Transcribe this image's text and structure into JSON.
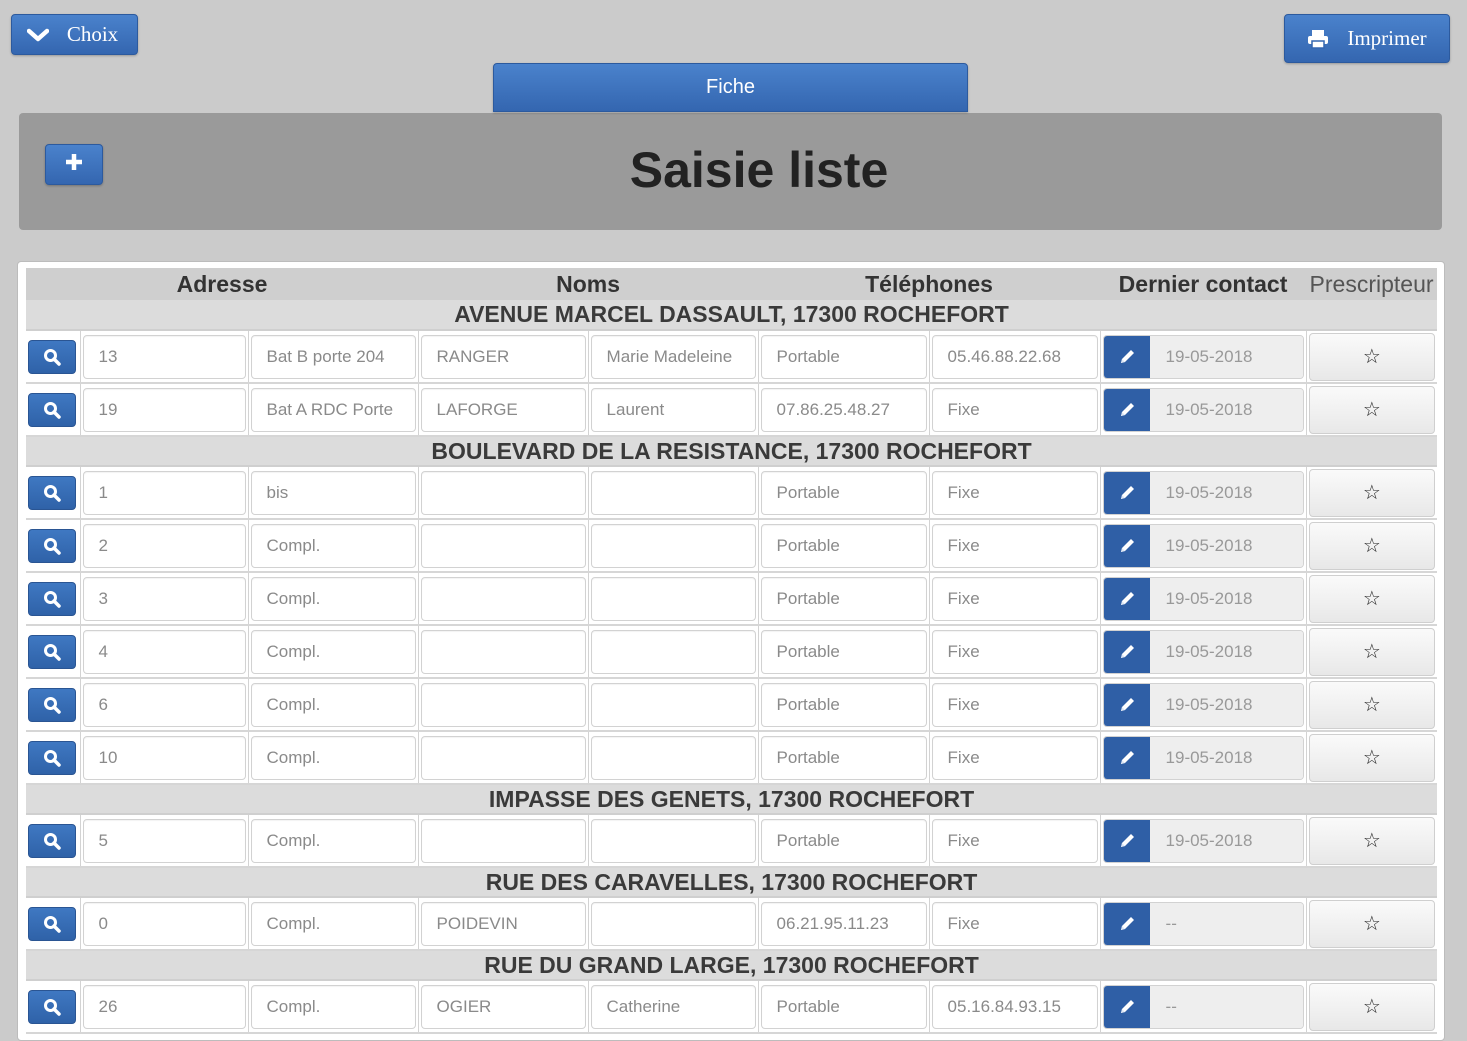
{
  "toolbar": {
    "choix_label": "Choix",
    "print_label": "Imprimer",
    "fiche_label": "Fiche",
    "add_label": "+"
  },
  "header": {
    "title": "Saisie liste"
  },
  "colors": {
    "accent": "#3a6fb8",
    "edit_button": "#2f5fa6",
    "header_panel": "#9a9a9a",
    "background": "#cbcbcb"
  },
  "table": {
    "columns": [
      "Adresse",
      "Noms",
      "Téléphones",
      "Dernier contact",
      "Prescripteur"
    ],
    "groups": [
      {
        "street": "AVENUE MARCEL DASSAULT, 17300 ROCHEFORT",
        "rows": [
          {
            "number": "13",
            "complement": "Bat B porte 204",
            "last_name": "RANGER",
            "first_name": "Marie Madeleine",
            "phone1": "Portable",
            "phone2": "05.46.88.22.68",
            "last_contact": "19-05-2018",
            "prescriber_icon": "☆"
          },
          {
            "number": "19",
            "complement": "Bat A RDC Porte",
            "last_name": "LAFORGE",
            "first_name": "Laurent",
            "phone1": "07.86.25.48.27",
            "phone2": "Fixe",
            "last_contact": "19-05-2018",
            "prescriber_icon": "☆"
          }
        ]
      },
      {
        "street": "BOULEVARD DE LA RESISTANCE, 17300 ROCHEFORT",
        "rows": [
          {
            "number": "1",
            "complement": "bis",
            "last_name": "",
            "first_name": "",
            "phone1": "Portable",
            "phone2": "Fixe",
            "last_contact": "19-05-2018",
            "prescriber_icon": "☆"
          },
          {
            "number": "2",
            "complement": "Compl.",
            "last_name": "",
            "first_name": "",
            "phone1": "Portable",
            "phone2": "Fixe",
            "last_contact": "19-05-2018",
            "prescriber_icon": "☆"
          },
          {
            "number": "3",
            "complement": "Compl.",
            "last_name": "",
            "first_name": "",
            "phone1": "Portable",
            "phone2": "Fixe",
            "last_contact": "19-05-2018",
            "prescriber_icon": "☆"
          },
          {
            "number": "4",
            "complement": "Compl.",
            "last_name": "",
            "first_name": "",
            "phone1": "Portable",
            "phone2": "Fixe",
            "last_contact": "19-05-2018",
            "prescriber_icon": "☆"
          },
          {
            "number": "6",
            "complement": "Compl.",
            "last_name": "",
            "first_name": "",
            "phone1": "Portable",
            "phone2": "Fixe",
            "last_contact": "19-05-2018",
            "prescriber_icon": "☆"
          },
          {
            "number": "10",
            "complement": "Compl.",
            "last_name": "",
            "first_name": "",
            "phone1": "Portable",
            "phone2": "Fixe",
            "last_contact": "19-05-2018",
            "prescriber_icon": "☆"
          }
        ]
      },
      {
        "street": "IMPASSE DES GENETS, 17300 ROCHEFORT",
        "rows": [
          {
            "number": "5",
            "complement": "Compl.",
            "last_name": "",
            "first_name": "",
            "phone1": "Portable",
            "phone2": "Fixe",
            "last_contact": "19-05-2018",
            "prescriber_icon": "☆"
          }
        ]
      },
      {
        "street": "RUE DES CARAVELLES, 17300 ROCHEFORT",
        "rows": [
          {
            "number": "0",
            "complement": "Compl.",
            "last_name": "POIDEVIN",
            "first_name": "",
            "phone1": "06.21.95.11.23",
            "phone2": "Fixe",
            "last_contact": "--",
            "prescriber_icon": "☆"
          }
        ]
      },
      {
        "street": "RUE DU GRAND LARGE, 17300 ROCHEFORT",
        "rows": [
          {
            "number": "26",
            "complement": "Compl.",
            "last_name": "OGIER",
            "first_name": "Catherine",
            "phone1": "Portable",
            "phone2": "05.16.84.93.15",
            "last_contact": "--",
            "prescriber_icon": "☆"
          }
        ]
      }
    ]
  }
}
